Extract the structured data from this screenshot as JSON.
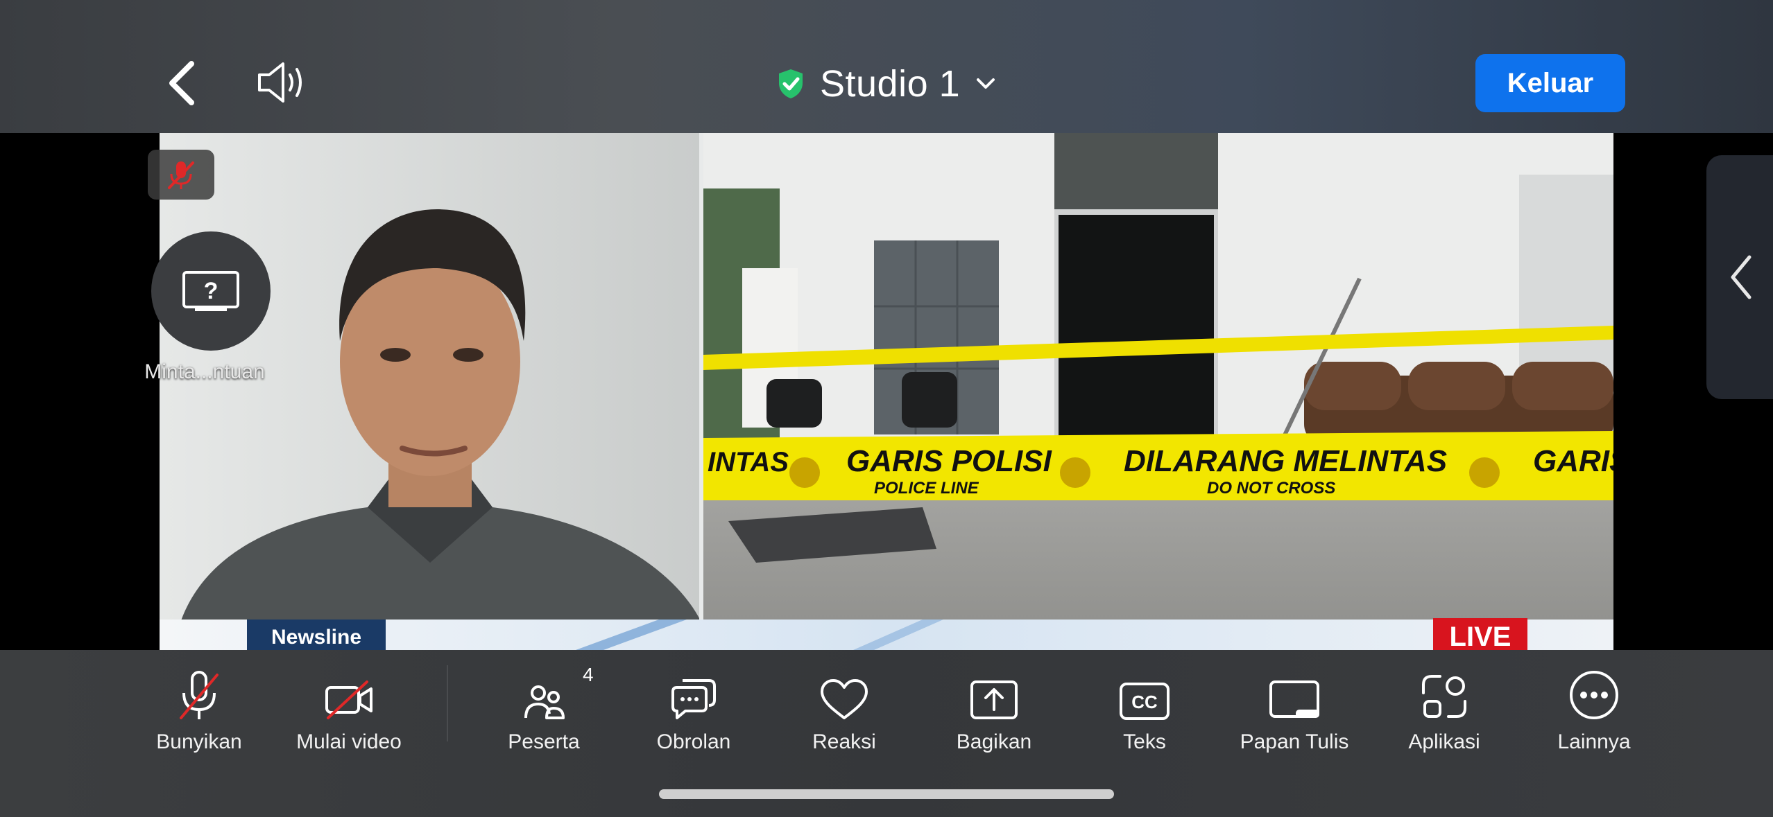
{
  "header": {
    "title": "Studio 1",
    "leave_label": "Keluar",
    "icons": {
      "back": "chevron-left-icon",
      "speaker": "speaker-icon",
      "secure": "shield-check-icon",
      "title_dropdown": "chevron-down-icon"
    }
  },
  "video": {
    "help_label": "Minta...ntuan",
    "help_icon": "question-screen-icon",
    "mute_icon": "mic-off-icon",
    "side_icon": "chevron-left-icon",
    "tape_text_1": "GARIS POLISI",
    "tape_sub_1": "POLICE LINE",
    "tape_text_2": "DILARANG MELINTAS",
    "tape_sub_2": "DO NOT CROSS",
    "tape_text_left": "INTAS",
    "tape_text_right": "GARIS",
    "program_label": "Newsline",
    "live_label": "LIVE"
  },
  "toolbar": {
    "items": [
      {
        "label": "Bunyikan",
        "icon": "mic-off-icon"
      },
      {
        "label": "Mulai video",
        "icon": "video-off-icon"
      },
      {
        "label": "Peserta",
        "icon": "participants-icon",
        "count": "4"
      },
      {
        "label": "Obrolan",
        "icon": "chat-icon"
      },
      {
        "label": "Reaksi",
        "icon": "heart-icon"
      },
      {
        "label": "Bagikan",
        "icon": "share-icon"
      },
      {
        "label": "Teks",
        "icon": "cc-icon"
      },
      {
        "label": "Papan Tulis",
        "icon": "whiteboard-icon"
      },
      {
        "label": "Aplikasi",
        "icon": "apps-icon"
      },
      {
        "label": "Lainnya",
        "icon": "more-icon"
      }
    ]
  },
  "colors": {
    "accent": "#0e72ed",
    "secure": "#27c26c",
    "muted": "#e02828",
    "tape": "#f2e600",
    "live": "#d8141e"
  }
}
